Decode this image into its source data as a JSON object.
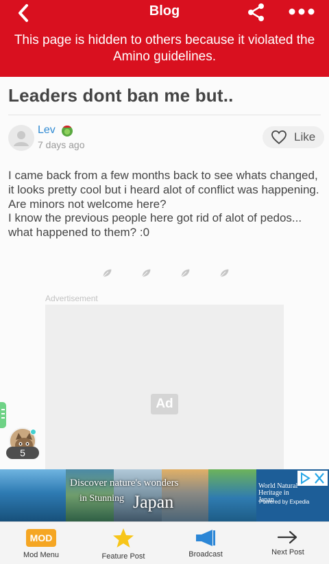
{
  "header": {
    "title": "Blog",
    "notice": "This page is hidden to others because it violated the Amino guidelines."
  },
  "post": {
    "title": "Leaders dont ban me but..",
    "author": "Lev",
    "time": "7 days ago",
    "like_label": "Like",
    "body": [
      "I came back from a few months back to see whats changed, it looks pretty cool but i heard alot of conflict was happening.",
      "Are minors not welcome here?",
      "I know the previous people here got rid of alot of pedos... what happened to them? :0"
    ]
  },
  "ad": {
    "label": "Advertisement",
    "badge": "Ad",
    "banner": {
      "line1": "Discover nature's wonders",
      "line2": "in Stunning",
      "line3": "Japan",
      "side_text": "World Natural Heritage in Japan",
      "powered": "Powered by  Expedia"
    }
  },
  "online": {
    "count": "5"
  },
  "bottom_nav": [
    {
      "label": "Mod Menu",
      "icon": "mod-icon",
      "icon_text": "MOD"
    },
    {
      "label": "Feature Post",
      "icon": "star-icon"
    },
    {
      "label": "Broadcast",
      "icon": "megaphone-icon"
    },
    {
      "label": "Next Post",
      "icon": "arrow-right-icon"
    }
  ],
  "colors": {
    "header_bg": "#d9101f",
    "author_link": "#2f8ad3",
    "star": "#f7c519",
    "broadcast": "#2b86d6",
    "mod_badge": "#f5a623"
  }
}
